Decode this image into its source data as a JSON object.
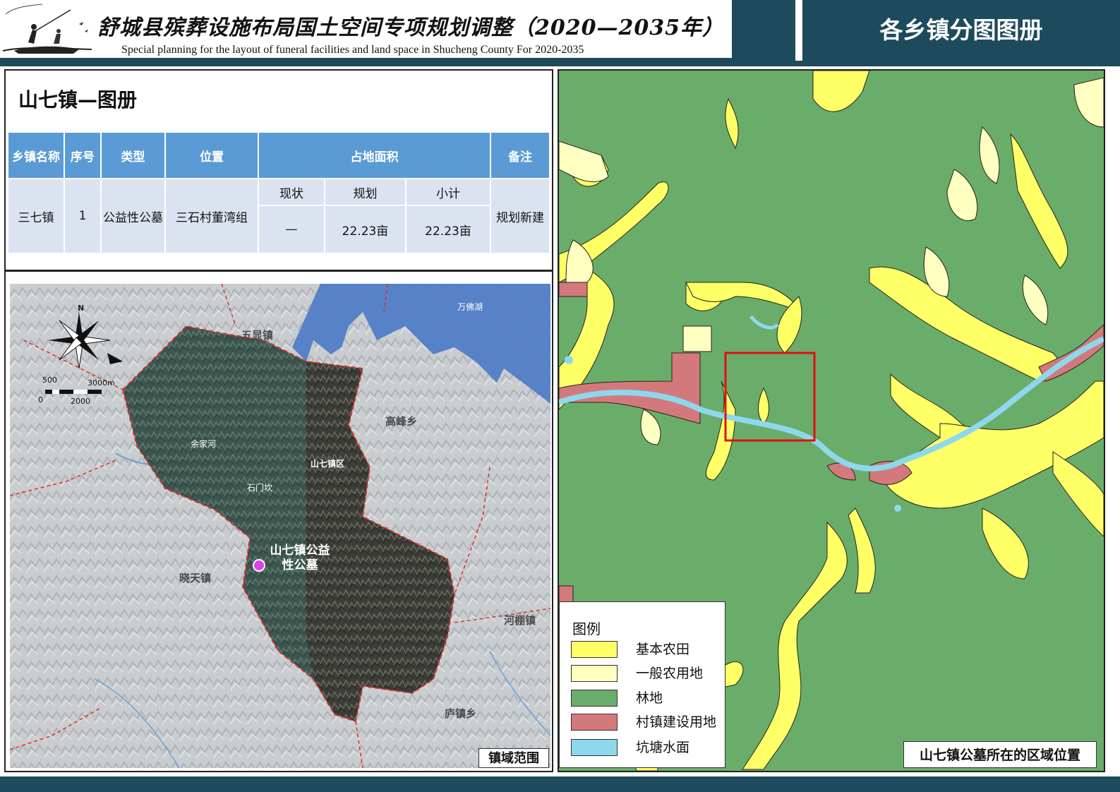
{
  "header": {
    "title_cn": "舒城县殡葬设施布局国土空间专项规划调整（2020—2035年）",
    "title_en": "Special planning for the layout of funeral facilities and land space in Shucheng County For 2020-2035",
    "section_title": "各乡镇分图图册"
  },
  "panel_title": "山七镇—图册",
  "table": {
    "headers": {
      "town": "乡镇名称",
      "seq": "序号",
      "type": "类型",
      "location": "位置",
      "area": "占地面积",
      "note": "备注"
    },
    "subheaders": {
      "current": "现状",
      "planned": "规划",
      "subtotal": "小计"
    },
    "row": {
      "town": "三七镇",
      "seq": "1",
      "type": "公益性公墓",
      "location": "三石村董湾组",
      "current": "—",
      "planned": "22.23亩",
      "subtotal": "22.23亩",
      "note": "规划新建"
    }
  },
  "overview_map": {
    "caption": "镇域范围",
    "north_label": "N",
    "scale": {
      "s500": "500",
      "s3000": "3000m",
      "s0": "0",
      "s2000": "2000"
    },
    "labels": {
      "wuxian": "五显镇",
      "wanfo": "万佛湖",
      "gaofeng": "高峰乡",
      "yujiahe": "余家河",
      "shanqi_area": "山七镇区",
      "shimenkan": "石门坎",
      "xiaotian": "晓天镇",
      "hepeng": "河棚镇",
      "luzhen": "庐镇乡",
      "site": "山七镇公益性公墓"
    }
  },
  "landuse_map": {
    "caption": "山七镇公墓所在的区域位置",
    "legend_title": "图例",
    "legend": [
      {
        "label": "基本农田",
        "color": "#ffff66"
      },
      {
        "label": "一般农用地",
        "color": "#ffffc0"
      },
      {
        "label": "林地",
        "color": "#6aad6a"
      },
      {
        "label": "村镇建设用地",
        "color": "#d4797b"
      },
      {
        "label": "坑塘水面",
        "color": "#8ed8ee"
      }
    ]
  }
}
